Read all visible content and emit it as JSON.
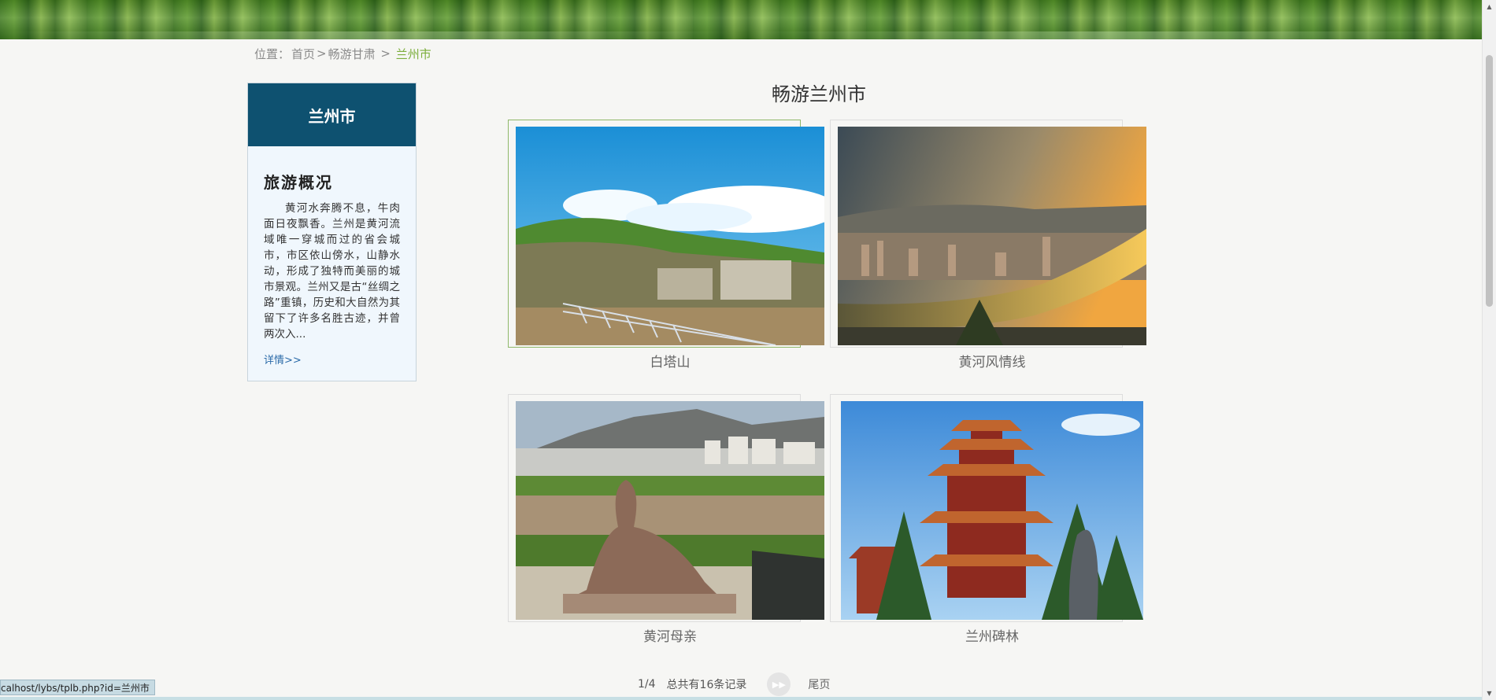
{
  "breadcrumb": {
    "prefix": "位置：",
    "home": "首页",
    "sep1": " >",
    "section": "畅游甘肃",
    "sep2": " > ",
    "current": "兰州市"
  },
  "sidebar": {
    "header": "兰州市",
    "title": "旅游概况",
    "text": "黄河水奔腾不息，牛肉面日夜飘香。兰州是黄河流域唯一穿城而过的省会城市，市区依山傍水，山静水动，形成了独特而美丽的城市景观。兰州又是古“丝绸之路”重镇，历史和大自然为其留下了许多名胜古迹，并曾两次入...",
    "more_label": "详情>>"
  },
  "main": {
    "title": "畅游兰州市",
    "cards": [
      {
        "caption": "白塔山",
        "icon": "baitashan-photo"
      },
      {
        "caption": "黄河风情线",
        "icon": "yellow-river-scenic-line-photo"
      },
      {
        "caption": "黄河母亲",
        "icon": "yellow-river-mother-statue-photo"
      },
      {
        "caption": "兰州碑林",
        "icon": "lanzhou-stele-forest-photo"
      }
    ]
  },
  "pagination": {
    "pages": "1/4",
    "total": "总共有16条记录",
    "next_icon": "fast-forward-icon",
    "last_label": "尾页"
  },
  "status_bar": {
    "url": "calhost/lybs/tplb.php?id=兰州市"
  },
  "colors": {
    "sidebar_header": "#0e5170",
    "accent_green": "#7cae3c",
    "link_blue": "#2a6aa8"
  }
}
